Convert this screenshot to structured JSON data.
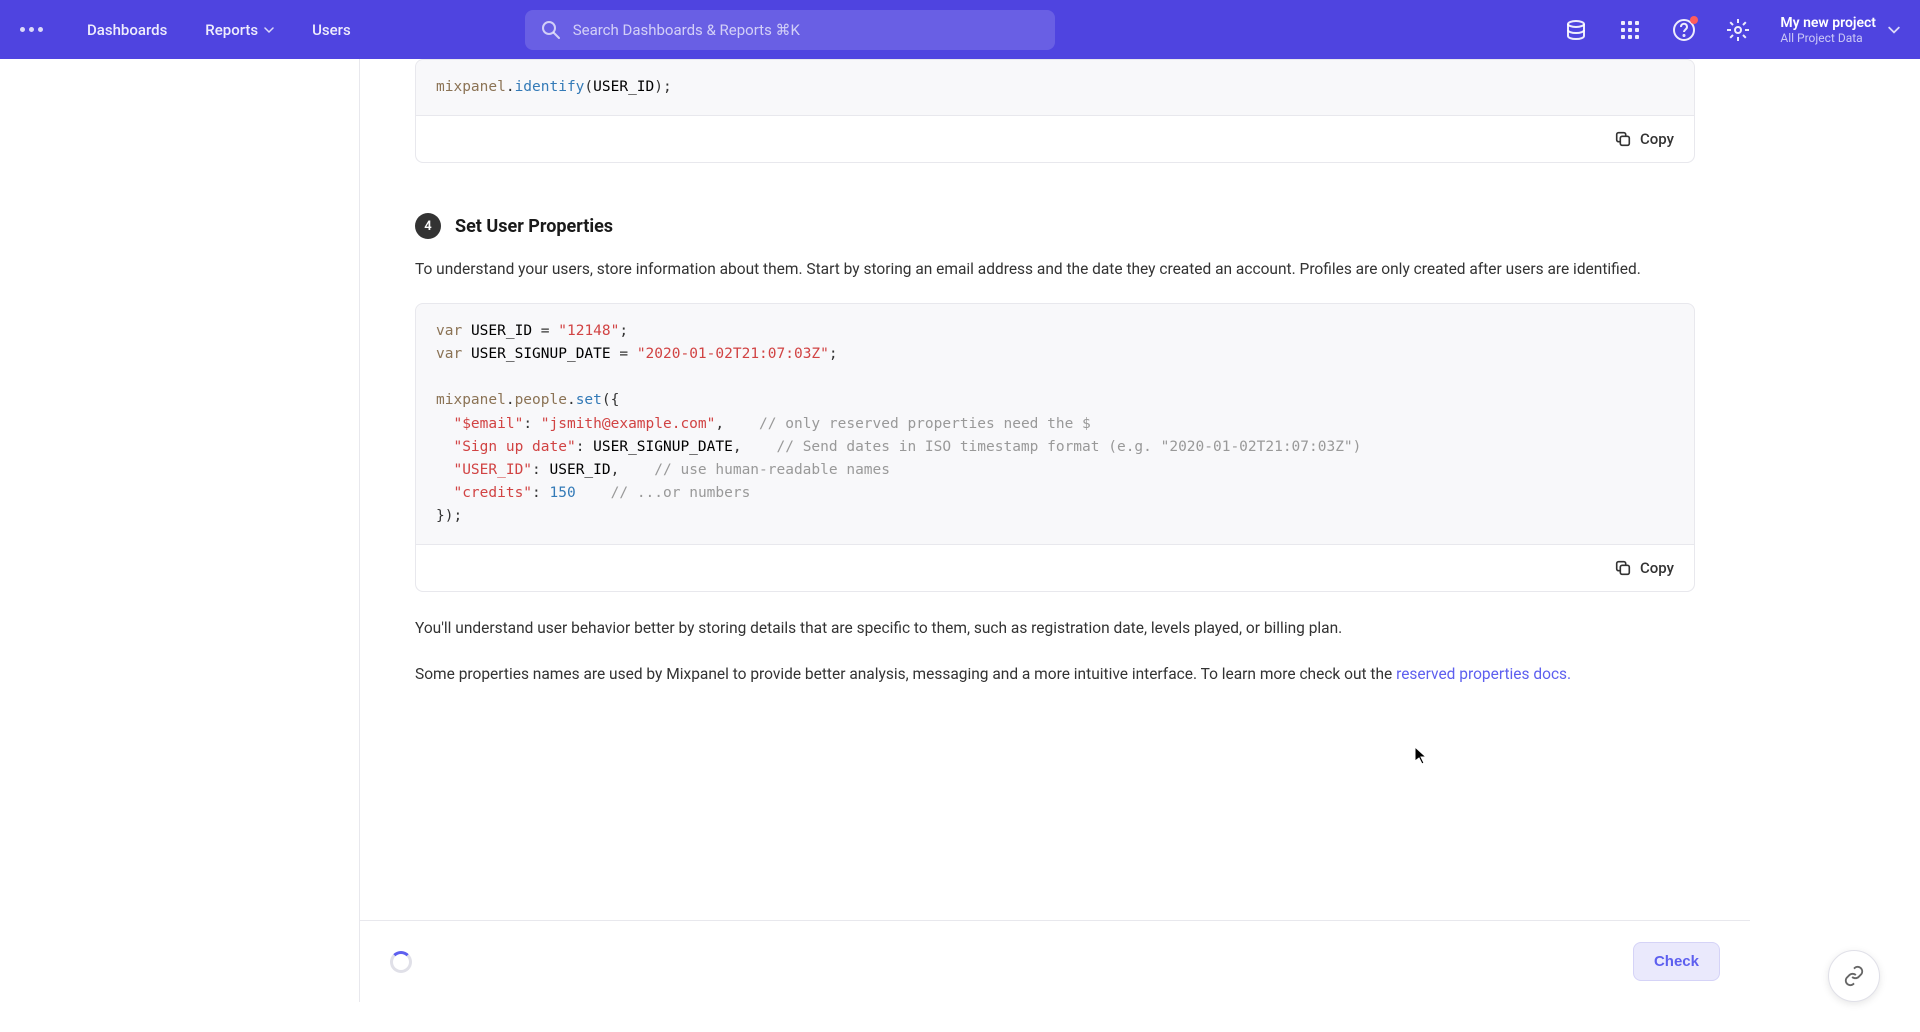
{
  "header": {
    "nav": {
      "dashboards": "Dashboards",
      "reports": "Reports",
      "users": "Users"
    },
    "search_placeholder": "Search Dashboards & Reports ⌘K",
    "project": {
      "name": "My new project",
      "subtitle": "All Project Data"
    }
  },
  "content": {
    "code1": {
      "line1_class": "mixpanel",
      "line1_method": "identify",
      "line1_arg": "USER_ID",
      "copy_label": "Copy"
    },
    "step4": {
      "number": "4",
      "title": "Set User Properties",
      "description": "To understand your users, store information about them. Start by storing an email address and the date they created an account. Profiles are only created after users are identified.",
      "behavior_text": "You'll understand user behavior better by storing details that are specific to them, such as registration date, levels played, or billing plan.",
      "properties_text": "Some properties names are used by Mixpanel to provide better analysis, messaging and a more intuitive interface. To learn more check out the ",
      "link_text": "reserved properties docs."
    },
    "code2": {
      "var1_name": "USER_ID",
      "var1_value": "\"12148\"",
      "var2_name": "USER_SIGNUP_DATE",
      "var2_value": "\"2020-01-02T21:07:03Z\"",
      "class": "mixpanel",
      "prop": "people",
      "method": "set",
      "key1": "\"$email\"",
      "val1": "\"jsmith@example.com\"",
      "comment1": "// only reserved properties need the $",
      "key2": "\"Sign up date\"",
      "val2": "USER_SIGNUP_DATE",
      "comment2": "// Send dates in ISO timestamp format (e.g. \"2020-01-02T21:07:03Z\")",
      "key3": "\"USER_ID\"",
      "val3": "USER_ID",
      "comment3": "// use human-readable names",
      "key4": "\"credits\"",
      "val4": "150",
      "comment4": "// ...or numbers",
      "copy_label": "Copy"
    },
    "check_button": "Check"
  }
}
